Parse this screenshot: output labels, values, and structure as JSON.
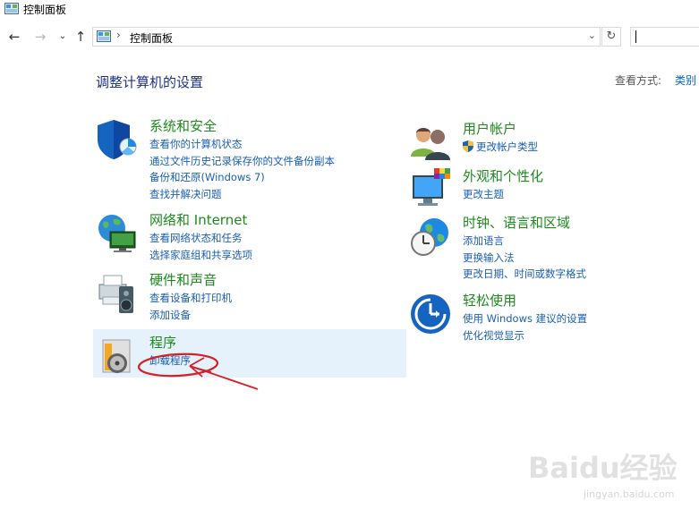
{
  "window": {
    "title": "控制面板"
  },
  "address": {
    "crumb": "控制面板",
    "separator": "›"
  },
  "header": {
    "title": "调整计算机的设置",
    "viewby_label": "查看方式:",
    "viewby_value": "类别"
  },
  "categories": {
    "system": {
      "title": "系统和安全",
      "links": [
        "查看你的计算机状态",
        "通过文件历史记录保存你的文件备份副本",
        "备份和还原(Windows 7)",
        "查找并解决问题"
      ]
    },
    "network": {
      "title": "网络和 Internet",
      "links": [
        "查看网络状态和任务",
        "选择家庭组和共享选项"
      ]
    },
    "hardware": {
      "title": "硬件和声音",
      "links": [
        "查看设备和打印机",
        "添加设备"
      ]
    },
    "programs": {
      "title": "程序",
      "links": [
        "卸载程序"
      ]
    },
    "users": {
      "title": "用户帐户",
      "links": [
        "更改帐户类型"
      ]
    },
    "appearance": {
      "title": "外观和个性化",
      "links": [
        "更改主题"
      ]
    },
    "clock": {
      "title": "时钟、语言和区域",
      "links": [
        "添加语言",
        "更换输入法",
        "更改日期、时间或数字格式"
      ]
    },
    "ease": {
      "title": "轻松使用",
      "links": [
        "使用 Windows 建议的设置",
        "优化视觉显示"
      ]
    }
  },
  "watermark": {
    "brand": "Baidu经验",
    "url": "jingyan.baidu.com"
  },
  "colors": {
    "heading": "#1e8a1e",
    "link": "#1a5fb4",
    "title": "#1e3287",
    "highlight": "#e5f1fb",
    "annotation": "#d42027"
  }
}
